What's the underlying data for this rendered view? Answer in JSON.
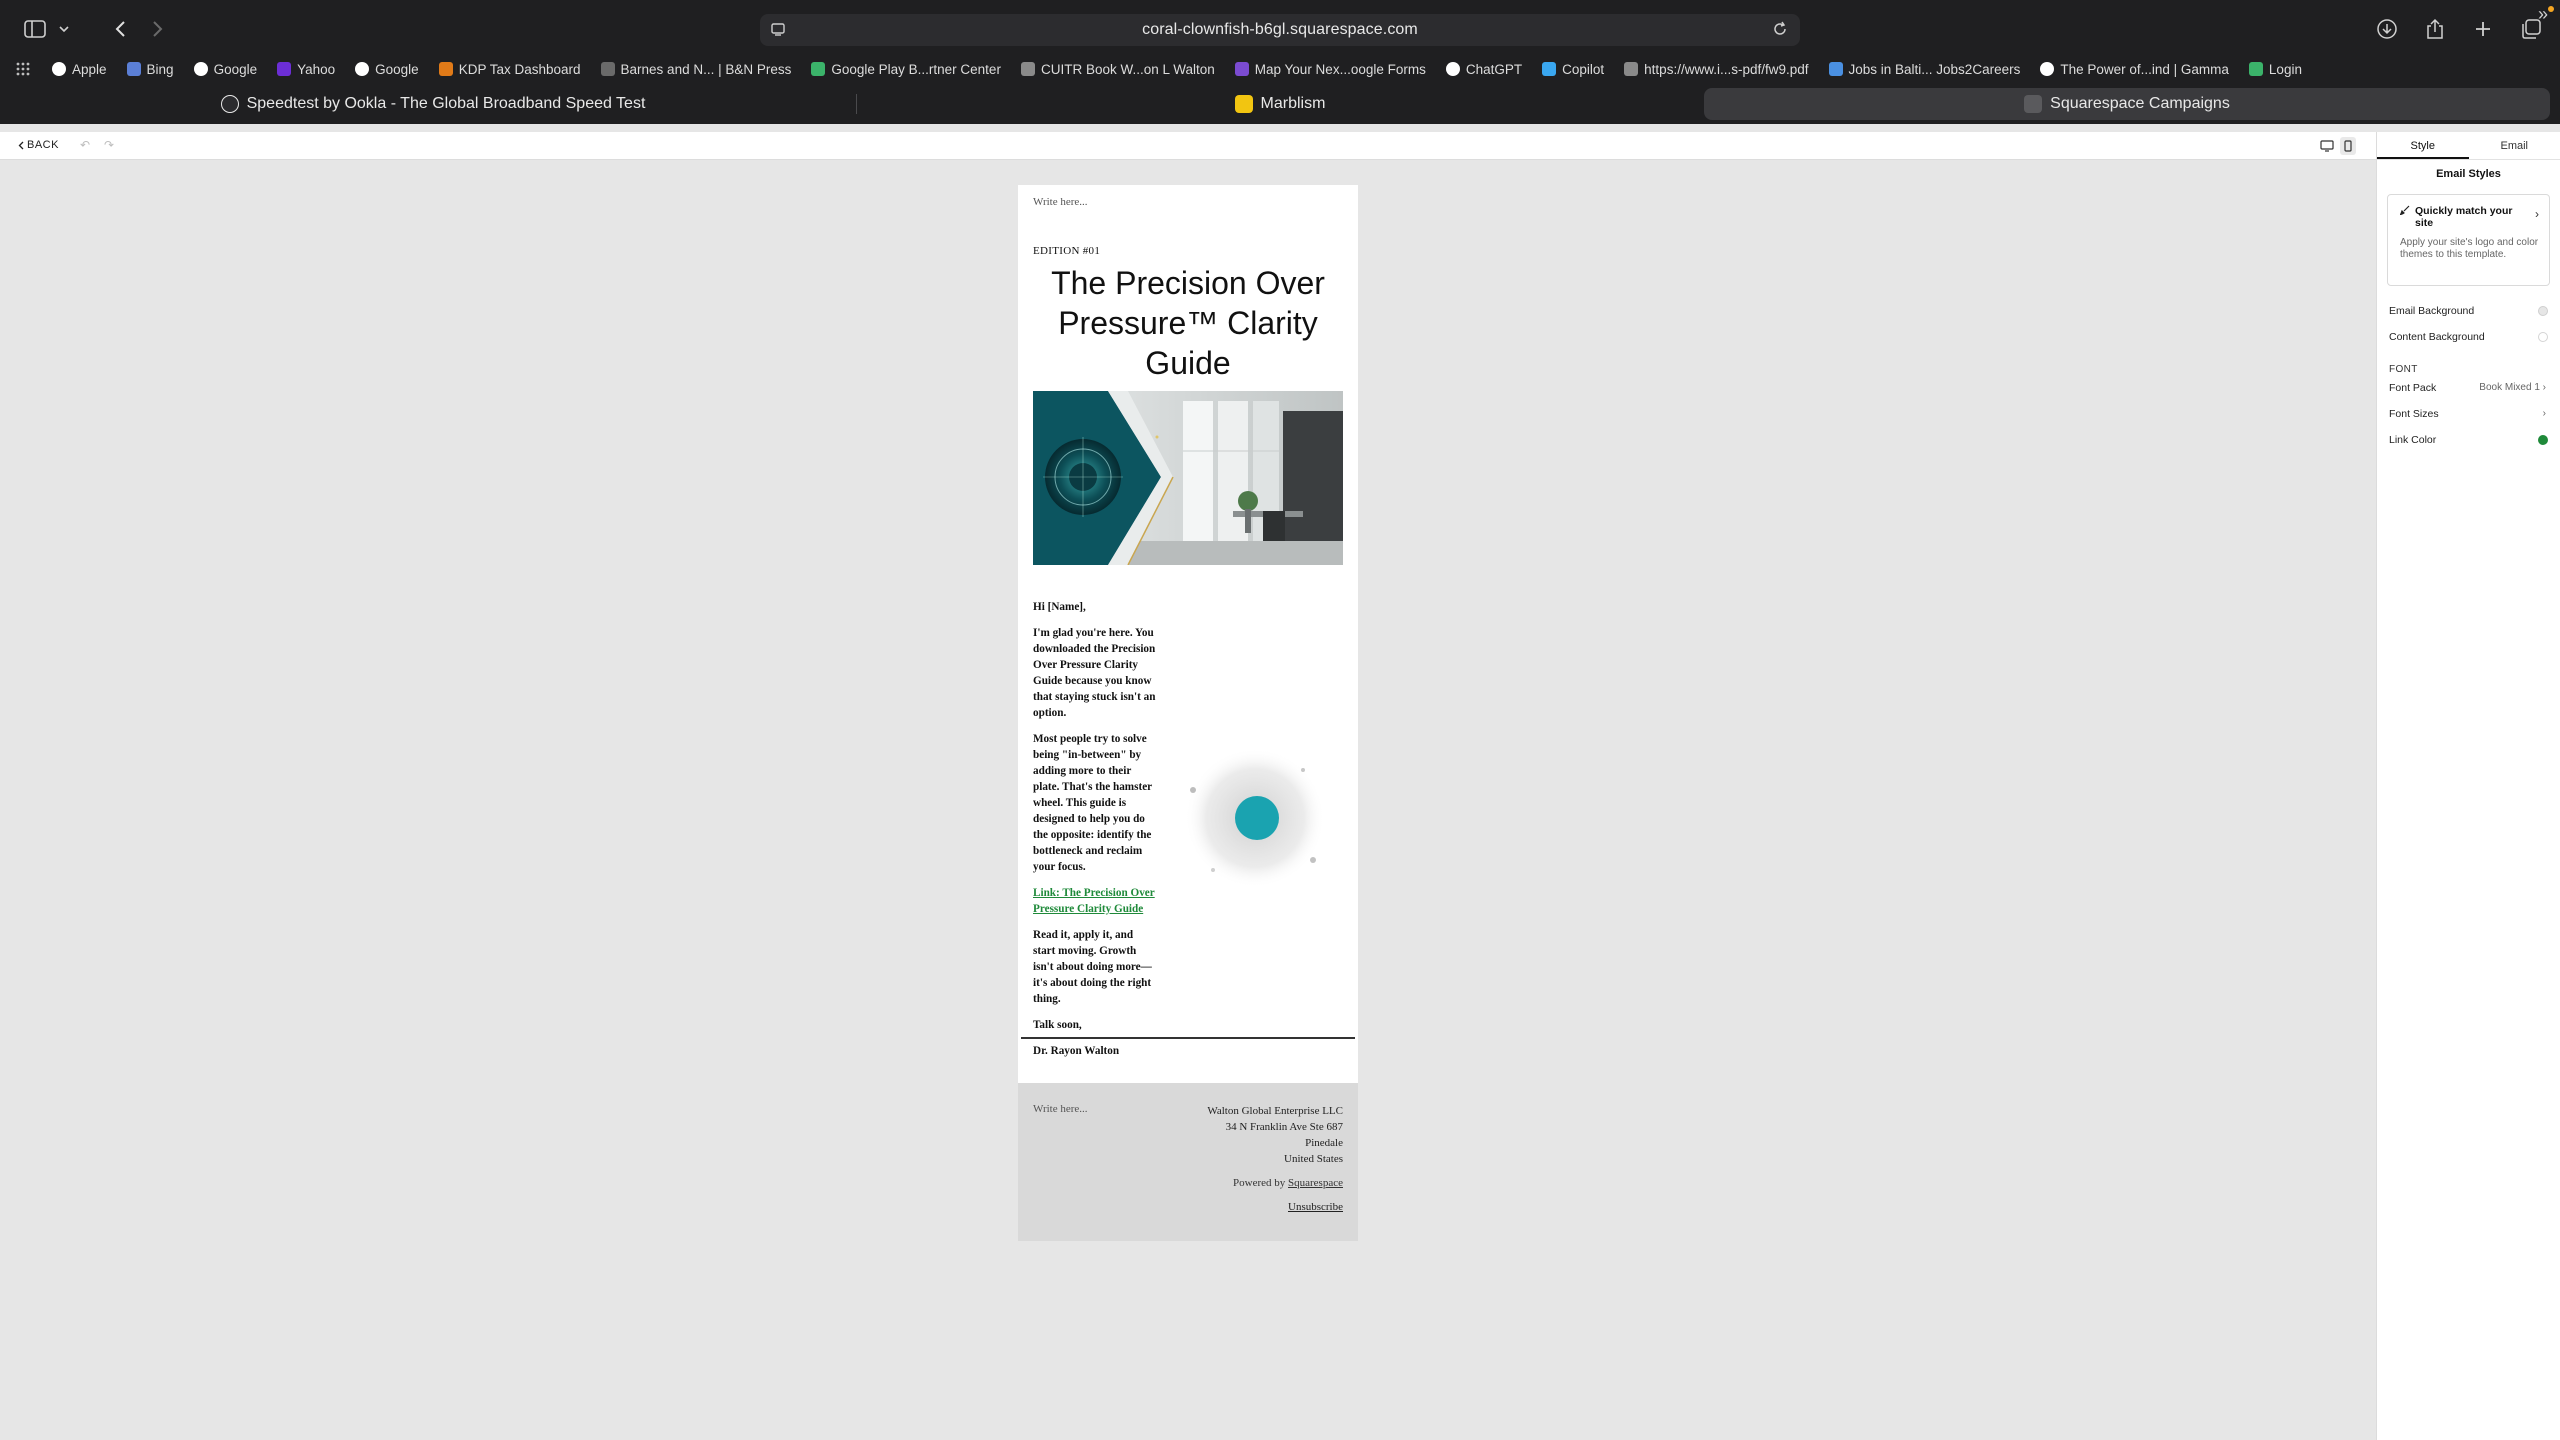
{
  "browser": {
    "url": "coral-clownfish-b6gl.squarespace.com",
    "bookmarks": [
      {
        "label": "Apple",
        "icon": "apple-icon",
        "color": "#ffffff"
      },
      {
        "label": "Bing",
        "icon": "bing-icon",
        "color": "#5b7fd6"
      },
      {
        "label": "Google",
        "icon": "google-icon",
        "color": "#ffffff"
      },
      {
        "label": "Yahoo",
        "icon": "yahoo-icon",
        "color": "#6c2ed6"
      },
      {
        "label": "Google",
        "icon": "google-icon",
        "color": "#ffffff"
      },
      {
        "label": "KDP Tax Dashboard",
        "icon": "amazon-icon",
        "color": "#e07a18"
      },
      {
        "label": "Barnes and N... | B&N Press",
        "icon": "bn-icon",
        "color": "#6a6a6a"
      },
      {
        "label": "Google Play B...rtner Center",
        "icon": "google-play-icon",
        "color": "#3bb36a"
      },
      {
        "label": "CUITR Book W...on L Walton",
        "icon": "globe-icon",
        "color": "#8a8a8a"
      },
      {
        "label": "Map Your Nex...oogle Forms",
        "icon": "forms-icon",
        "color": "#7b4bd1"
      },
      {
        "label": "ChatGPT",
        "icon": "chatgpt-icon",
        "color": "#ffffff"
      },
      {
        "label": "Copilot",
        "icon": "copilot-icon",
        "color": "#3aa7f0"
      },
      {
        "label": "https://www.i...s-pdf/fw9.pdf",
        "icon": "irs-icon",
        "color": "#8a8a8a"
      },
      {
        "label": "Jobs in Balti... Jobs2Careers",
        "icon": "search-icon",
        "color": "#4a90e2"
      },
      {
        "label": "The Power of...ind | Gamma",
        "icon": "gamma-icon",
        "color": "#ffffff"
      },
      {
        "label": "Login",
        "icon": "login-icon",
        "color": "#3bb36a"
      }
    ],
    "tabs": [
      {
        "label": "Speedtest by Ookla - The Global Broadband Speed Test",
        "icon": "speedtest-icon",
        "active": false
      },
      {
        "label": "Marblism",
        "icon": "marblism-icon",
        "active": false
      },
      {
        "label": "Squarespace Campaigns",
        "icon": "squarespace-icon",
        "active": true
      }
    ]
  },
  "app_header": {
    "back_label": "BACK"
  },
  "email": {
    "header_placeholder": "Write here...",
    "edition": "EDITION #01",
    "title": "The Precision Over Pressure™ Clarity Guide",
    "greeting": "Hi [Name],",
    "paragraph1": "I'm glad you're here. You downloaded the Precision Over Pressure Clarity Guide because you know that staying stuck isn't an option.",
    "paragraph2": "Most people try to solve being \"in-between\" by adding more to their plate. That's the hamster wheel. This guide is designed to help you do the opposite: identify the bottleneck and reclaim your focus.",
    "link_text": "Link: The Precision Over Pressure Clarity Guide",
    "paragraph3": "Read it, apply it, and start moving. Growth isn't about doing more—it's about doing the right thing.",
    "signoff": "Talk soon,",
    "signature": "Dr. Rayon Walton",
    "footer": {
      "placeholder": "Write here...",
      "company": "Walton Global Enterprise LLC",
      "street": "34 N Franklin Ave Ste 687",
      "city": "Pinedale",
      "country": "United States",
      "powered_prefix": "Powered by",
      "powered_link": "Squarespace",
      "unsubscribe": "Unsubscribe"
    },
    "link_color": "#1f8a3a",
    "accent_teal": "#1aa3b0"
  },
  "panel": {
    "tabs": [
      "Style",
      "Email"
    ],
    "active_tab": "Style",
    "title": "Email Styles",
    "match_title": "Quickly match your site",
    "match_desc": "Apply your site's logo and color themes to this template.",
    "email_background_label": "Email Background",
    "content_background_label": "Content Background",
    "font_section": "FONT",
    "font_pack_label": "Font Pack",
    "font_pack_value": "Book Mixed 1",
    "font_sizes_label": "Font Sizes",
    "link_color_label": "Link Color",
    "email_background_color": "#e6e6e6",
    "content_background_color": "#ffffff",
    "link_color": "#1f8a3a"
  }
}
